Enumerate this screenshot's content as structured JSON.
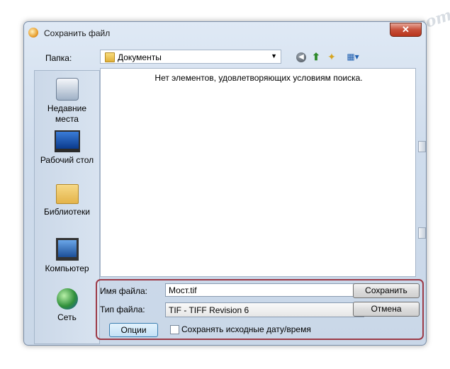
{
  "dialog": {
    "title": "Сохранить файл",
    "close_glyph": "✕"
  },
  "toolbar": {
    "lookin_label": "Папка:",
    "lookin_value": "Документы",
    "icons": [
      "back-icon",
      "up-folder-icon",
      "new-folder-icon",
      "views-menu-icon"
    ]
  },
  "places": [
    {
      "label": "Недавние места",
      "icon": "recent-places-icon"
    },
    {
      "label": "Рабочий стол",
      "icon": "desktop-icon"
    },
    {
      "label": "Библиотеки",
      "icon": "libraries-icon"
    },
    {
      "label": "Компьютер",
      "icon": "computer-icon"
    },
    {
      "label": "Сеть",
      "icon": "network-icon"
    }
  ],
  "filelist": {
    "empty_message": "Нет элементов, удовлетворяющих условиям поиска."
  },
  "form": {
    "filename_label": "Имя файла:",
    "filename_value": "Мост.tif",
    "filetype_label": "Тип файла:",
    "filetype_value": "TIF - TIFF Revision 6",
    "save_button": "Сохранить",
    "cancel_button": "Отмена",
    "options_button": "Опции",
    "keep_dates_label": "Сохранять исходные дату/время",
    "keep_dates_checked": false
  },
  "watermark": "Soringpcrepair.com",
  "colors": {
    "highlight_box": "#9c3a47",
    "options_button_border": "#3c7fb1"
  }
}
